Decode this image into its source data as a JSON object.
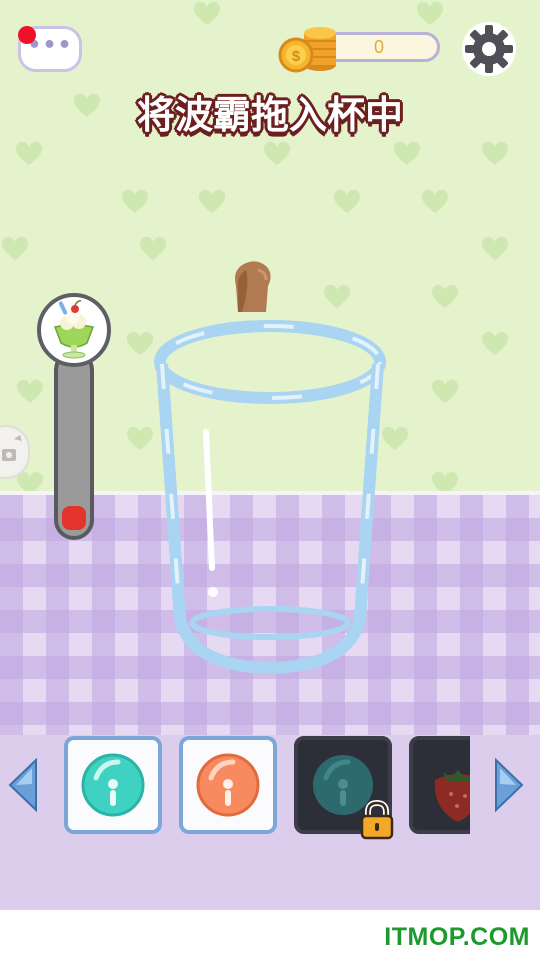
{
  "hud": {
    "coins": "0",
    "instruction": "将波霸拖入杯中",
    "chat_button_icon": "chat-dots-icon",
    "notification_dot": true,
    "settings_icon": "gear-icon"
  },
  "progress_meter": {
    "icon": "ice-cream-sundae-icon",
    "fill_fraction": 0.13,
    "fill_color": "#e3332b"
  },
  "scene": {
    "draggable_item": "boba-pearl",
    "container": "empty-glass-cup",
    "wall_color": "#e4f3cc",
    "tablecloth_color": "#e6daf2"
  },
  "ingredient_tray": {
    "items": [
      {
        "name": "teal-bubble",
        "locked": false,
        "color": "#3fd2c2"
      },
      {
        "name": "orange-bubble",
        "locked": false,
        "color": "#f78a5e"
      },
      {
        "name": "dark-teal-bubble",
        "locked": true,
        "color": "#2d6a6e"
      },
      {
        "name": "strawberry",
        "locked": false,
        "color": "#c0342b"
      }
    ]
  },
  "watermark": "ITMOP.COM"
}
